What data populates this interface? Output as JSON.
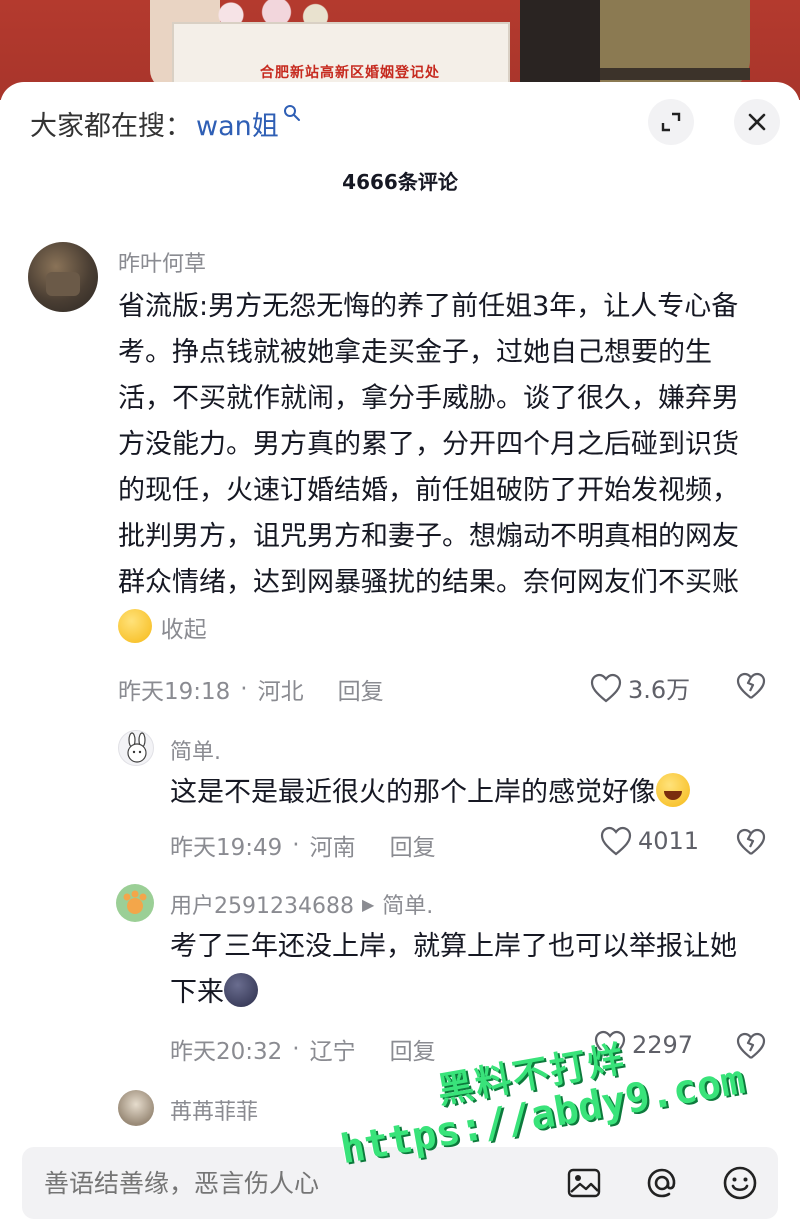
{
  "video": {
    "sign_text": "合肥新站高新区婚姻登记处"
  },
  "header": {
    "search_prefix": "大家都在搜：",
    "search_keyword": "wan姐",
    "comment_count": "4666条评论"
  },
  "comments": [
    {
      "username": "昨叶何草",
      "text": "省流版:男方无怨无悔的养了前任姐3年，让人专心备考。挣点钱就被她拿走买金子，过她自己想要的生活，不买就作就闹，拿分手威胁。谈了很久，嫌弃男方没能力。男方真的累了，分开四个月之后碰到识货的现任，火速订婚结婚，前任姐破防了开始发视频，批判男方，诅咒男方和妻子。想煽动不明真相的网友群众情绪，达到网暴骚扰的结果。奈何网友们不买账",
      "collapse": "收起",
      "time": "昨天19:18",
      "location": "河北",
      "reply": "回复",
      "likes": "3.6万"
    },
    {
      "username": "简单.",
      "text": "这是不是最近很火的那个上岸的感觉好像",
      "time": "昨天19:49",
      "location": "河南",
      "reply": "回复",
      "likes": "4011"
    },
    {
      "username": "用户2591234688",
      "reply_to": "简单.",
      "text": "考了三年还没上岸，就算上岸了也可以举报让她下来",
      "time": "昨天20:32",
      "location": "辽宁",
      "reply": "回复",
      "likes": "2297"
    },
    {
      "username": "苒苒菲菲"
    }
  ],
  "input": {
    "placeholder": "善语结善缘，恶言伤人心"
  },
  "watermark": {
    "line1": "黑料不打烊",
    "line2": "https://abdy9.com"
  },
  "icons": [
    "search-icon",
    "expand-icon",
    "close-icon",
    "heart-icon",
    "dislike-heart-icon",
    "image-icon",
    "at-icon",
    "emoji-icon"
  ],
  "colors": {
    "accent": "#2f5fb5",
    "muted": "#8a8b91",
    "watermark": "#39e37a"
  }
}
